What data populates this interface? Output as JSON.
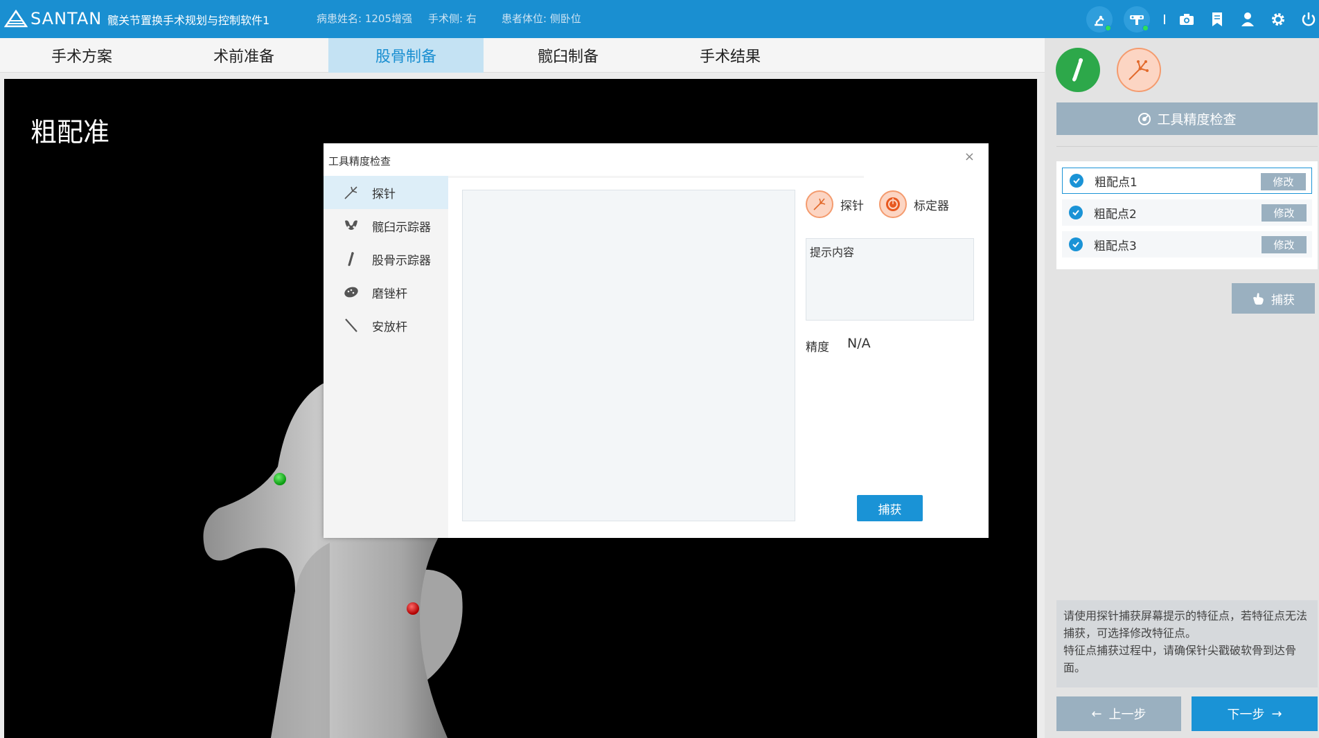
{
  "header": {
    "logo_text": "SANTAN",
    "app_title": "髋关节置换手术规划与控制软件1",
    "patient_name": "病患姓名: 1205增强",
    "surgery_side": "手术侧: 右",
    "patient_position": "患者体位: 侧卧位",
    "icons": [
      "robot-arm-status-icon",
      "camera-tracker-status-icon",
      "camera-icon",
      "bookmark-icon",
      "user-icon",
      "settings-icon",
      "power-icon"
    ],
    "status_color": "#2de05a"
  },
  "tabs": [
    {
      "label": "手术方案",
      "active": false
    },
    {
      "label": "术前准备",
      "active": false
    },
    {
      "label": "股骨制备",
      "active": true
    },
    {
      "label": "髋臼制备",
      "active": false
    },
    {
      "label": "手术结果",
      "active": false
    }
  ],
  "viewport": {
    "title": "粗配准",
    "points": [
      {
        "name": "green-landmark",
        "color": "#17c21f"
      },
      {
        "name": "red-landmark",
        "color": "#e01010"
      }
    ]
  },
  "dialog": {
    "title": "工具精度检查",
    "close": "×",
    "menu": [
      {
        "label": "探针",
        "icon": "probe-icon",
        "active": true
      },
      {
        "label": "髋臼示踪器",
        "icon": "pelvis-icon",
        "active": false
      },
      {
        "label": "股骨示踪器",
        "icon": "femur-icon",
        "active": false
      },
      {
        "label": "磨锉杆",
        "icon": "reamer-icon",
        "active": false
      },
      {
        "label": "安放杆",
        "icon": "impactor-icon",
        "active": false
      }
    ],
    "tool_probe": "探针",
    "tool_calibrator": "标定器",
    "hint": "提示内容",
    "precision_label": "精度",
    "precision_value": "N/A",
    "capture": "捕获"
  },
  "right_panel": {
    "tool_check": "工具精度检查",
    "points": [
      {
        "label": "粗配点1",
        "edit": "修改",
        "selected": true
      },
      {
        "label": "粗配点2",
        "edit": "修改",
        "selected": false
      },
      {
        "label": "粗配点3",
        "edit": "修改",
        "selected": false
      }
    ],
    "capture": "捕获",
    "note": "请使用探针捕获屏幕提示的特征点，若特征点无法捕获，可选择修改特征点。\n特征点捕获过程中，请确保针尖戳破软骨到达骨面。",
    "prev": "上一步",
    "next": "下一步"
  },
  "colors": {
    "primary": "#1a8fd1",
    "button_gray": "#9ab0c0",
    "femur_green": "#2da84a",
    "probe_orange": "#f49b6e"
  }
}
